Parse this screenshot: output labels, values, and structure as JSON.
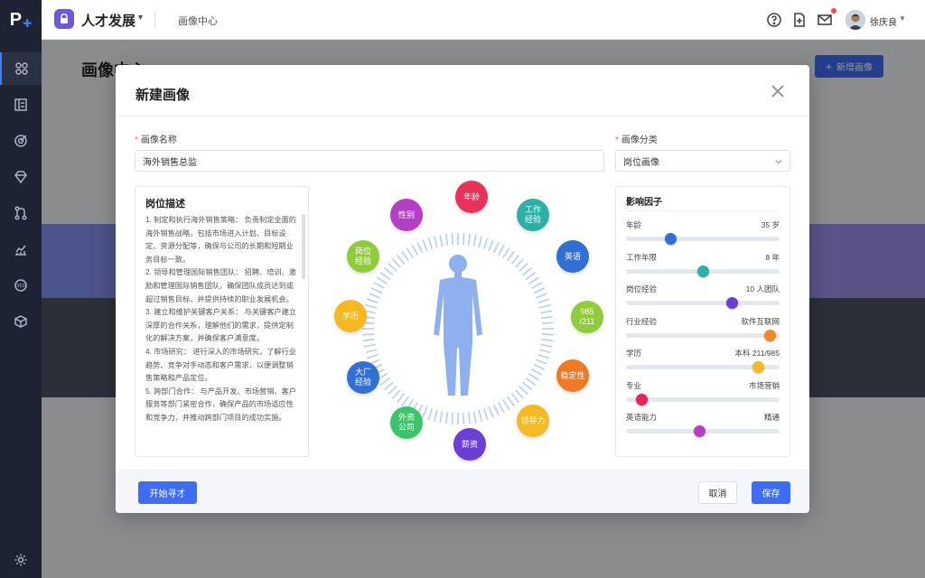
{
  "app": {
    "brand_letter": "P",
    "title": "人才发展",
    "breadcrumb": "画像中心"
  },
  "user": {
    "name": "徐庆良"
  },
  "page": {
    "title": "画像中心",
    "new_button": "新增画像"
  },
  "modal": {
    "title": "新建画像",
    "name_label": "画像名称",
    "name_value": "海外销售总监",
    "category_label": "画像分类",
    "category_value": "岗位画像",
    "desc_title": "岗位描述",
    "desc_paragraphs": [
      "1. 制定和执行海外销售策略： 负责制定全面的海外销售战略，包括市场进入计划、目标设定、资源分配等，确保与公司的长期和短期业务目标一致。",
      "2. 领导和管理国际销售团队： 招聘、培训、激励和管理国际销售团队，确保团队成员达到或超过销售目标，并提供持续的职业发展机会。",
      "3. 建立和维护关键客户关系： 与关键客户建立深厚的合作关系，理解他们的需求，提供定制化的解决方案，并确保客户满意度。",
      "4. 市场研究： 进行深入的市场研究，了解行业趋势、竞争对手动态和客户需求，以便调整销售策略和产品定位。",
      "5. 跨部门合作： 与产品开发、市场营销、客户服务等部门紧密合作，确保产品的市场适应性和竞争力，并推动跨部门项目的成功实施。"
    ],
    "factor_title": "影响因子",
    "factors": [
      {
        "label": "年龄",
        "value": "35 岁",
        "level": 0.29,
        "color": "#2f6fd6"
      },
      {
        "label": "工作年限",
        "value": "8 年",
        "level": 0.5,
        "color": "#2ab0a4"
      },
      {
        "label": "岗位经验",
        "value": "10 人团队",
        "level": 0.69,
        "color": "#6a3fd6"
      },
      {
        "label": "行业经验",
        "value": "软件互联网",
        "level": 0.94,
        "color": "#f08a23"
      },
      {
        "label": "学历",
        "value": "本科 211/985",
        "level": 0.86,
        "color": "#f5b921"
      },
      {
        "label": "专业",
        "value": "市场营销",
        "level": 0.1,
        "color": "#e8225a"
      },
      {
        "label": "英语能力",
        "value": "精通",
        "level": 0.48,
        "color": "#b23fc4"
      }
    ],
    "bubbles": [
      {
        "text": "年龄",
        "color": "#e8325a"
      },
      {
        "text": "工作经验",
        "color": "#2ab0a4"
      },
      {
        "text": "英语",
        "color": "#2f6fd6"
      },
      {
        "text": "985/211",
        "color": "#8fcc3a"
      },
      {
        "text": "稳定性",
        "color": "#f07a23"
      },
      {
        "text": "领导力",
        "color": "#f5b921"
      },
      {
        "text": "薪资",
        "color": "#6a3fd6"
      },
      {
        "text": "外资公司",
        "color": "#3cc46a"
      },
      {
        "text": "大厂经验",
        "color": "#2f6fd6"
      },
      {
        "text": "学历",
        "color": "#f5b921"
      },
      {
        "text": "岗位经验",
        "color": "#8fcc3a"
      },
      {
        "text": "性别",
        "color": "#b23fc4"
      }
    ],
    "start_button": "开始寻才",
    "cancel_button": "取消",
    "save_button": "保存"
  }
}
